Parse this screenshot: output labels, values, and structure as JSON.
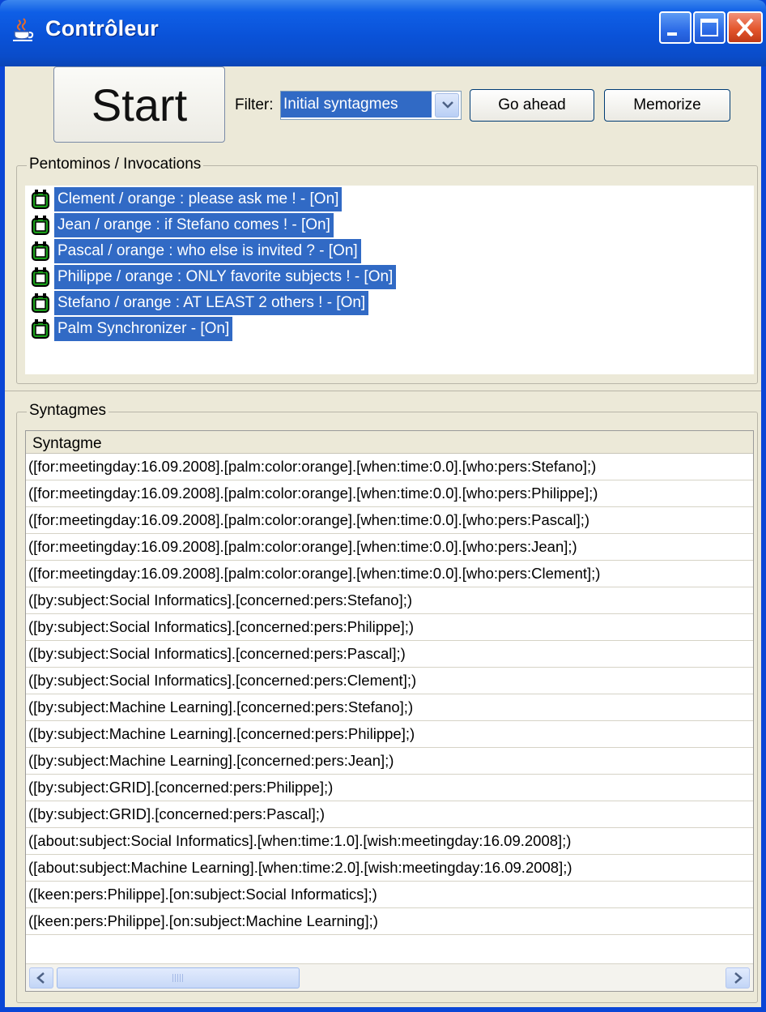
{
  "window": {
    "title": "Contrôleur",
    "title_icon": "java-cup-icon",
    "controls": [
      "minimize-icon",
      "maximize-icon",
      "close-icon"
    ]
  },
  "toolbar": {
    "start_label": "Start",
    "filter_label": "Filter:",
    "filter_value": "Initial syntagmes",
    "go_ahead_label": "Go ahead",
    "memorize_label": "Memorize"
  },
  "pentominos": {
    "group_title": "Pentominos / Invocations",
    "item_icon": "pentomino-plug-icon",
    "items": [
      {
        "label": "Clement / orange : please ask me ! - [On]"
      },
      {
        "label": "Jean / orange : if Stefano comes ! - [On]"
      },
      {
        "label": "Pascal / orange : who else is invited ? - [On]"
      },
      {
        "label": "Philippe / orange : ONLY favorite subjects ! - [On]"
      },
      {
        "label": "Stefano / orange : AT LEAST 2 others ! - [On]"
      },
      {
        "label": "Palm Synchronizer - [On]"
      }
    ]
  },
  "syntagmes": {
    "group_title": "Syntagmes",
    "column_header": "Syntagme",
    "rows": [
      {
        "text": "([for:meetingday:16.09.2008].[palm:color:orange].[when:time:0.0].[who:pers:Stefano];)"
      },
      {
        "text": "([for:meetingday:16.09.2008].[palm:color:orange].[when:time:0.0].[who:pers:Philippe];)"
      },
      {
        "text": "([for:meetingday:16.09.2008].[palm:color:orange].[when:time:0.0].[who:pers:Pascal];)"
      },
      {
        "text": "([for:meetingday:16.09.2008].[palm:color:orange].[when:time:0.0].[who:pers:Jean];)"
      },
      {
        "text": "([for:meetingday:16.09.2008].[palm:color:orange].[when:time:0.0].[who:pers:Clement];)"
      },
      {
        "text": "([by:subject:Social Informatics].[concerned:pers:Stefano];)"
      },
      {
        "text": "([by:subject:Social Informatics].[concerned:pers:Philippe];)"
      },
      {
        "text": "([by:subject:Social Informatics].[concerned:pers:Pascal];)"
      },
      {
        "text": "([by:subject:Social Informatics].[concerned:pers:Clement];)"
      },
      {
        "text": "([by:subject:Machine Learning].[concerned:pers:Stefano];)"
      },
      {
        "text": "([by:subject:Machine Learning].[concerned:pers:Philippe];)"
      },
      {
        "text": "([by:subject:Machine Learning].[concerned:pers:Jean];)"
      },
      {
        "text": "([by:subject:GRID].[concerned:pers:Philippe];)"
      },
      {
        "text": "([by:subject:GRID].[concerned:pers:Pascal];)"
      },
      {
        "text": "([about:subject:Social Informatics].[when:time:1.0].[wish:meetingday:16.09.2008];)"
      },
      {
        "text": "([about:subject:Machine Learning].[when:time:2.0].[wish:meetingday:16.09.2008];)"
      },
      {
        "text": "([keen:pers:Philippe].[on:subject:Social Informatics];)"
      },
      {
        "text": "([keen:pers:Philippe].[on:subject:Machine Learning];)"
      }
    ]
  },
  "colors": {
    "titlebar": "#0a52d8",
    "selection": "#316ac5",
    "window_bg": "#ece9d8",
    "plug_green": "#1aa01a"
  }
}
